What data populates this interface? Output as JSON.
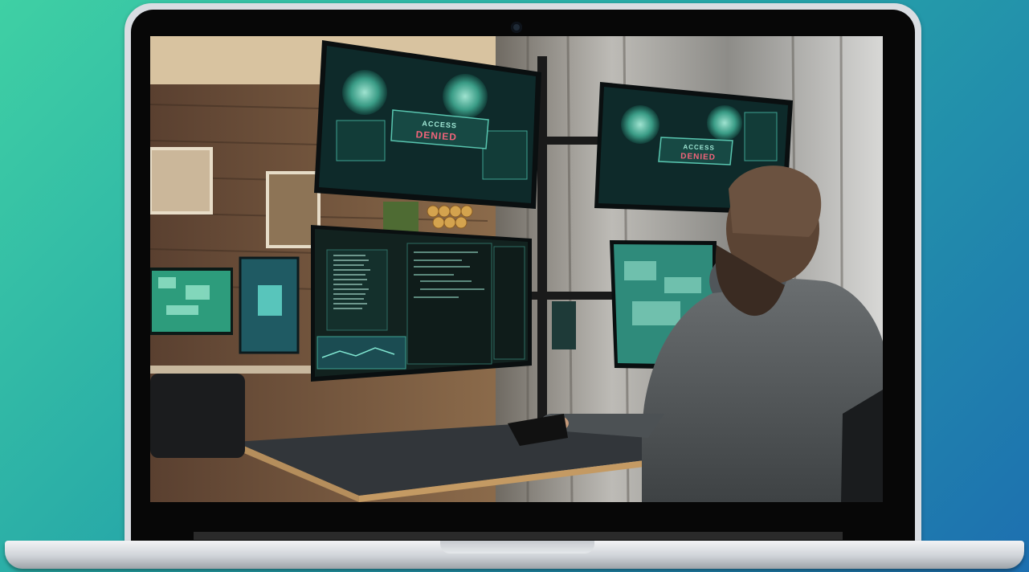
{
  "photo": {
    "monitor_top_left": {
      "title": "ACCESS",
      "subtitle": "DENIED"
    },
    "monitor_top_right": {
      "title": "ACCESS",
      "subtitle": "DENIED"
    }
  }
}
